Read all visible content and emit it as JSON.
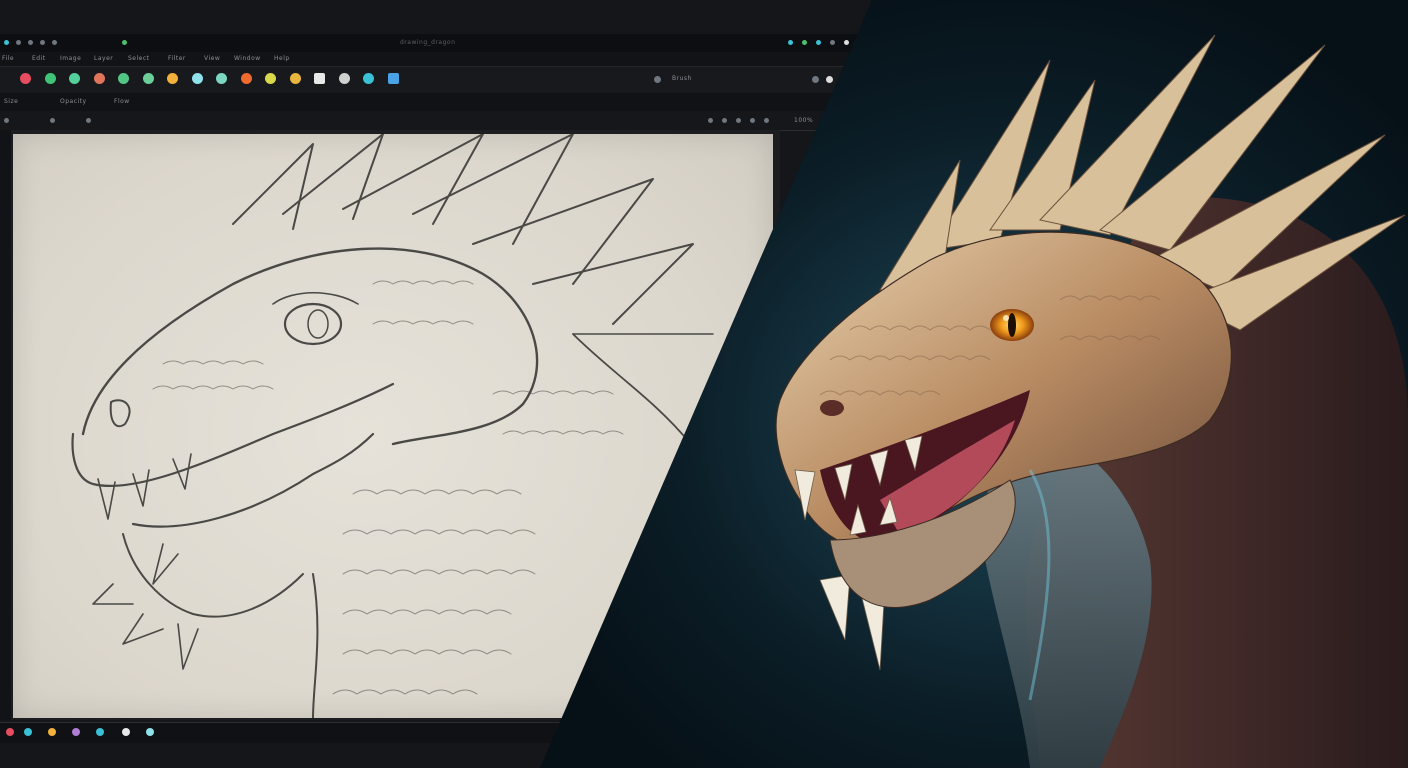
{
  "window": {
    "title": "drawing_dragon"
  },
  "menu": {
    "items": [
      "File",
      "Edit",
      "Image",
      "Layer",
      "Select",
      "Filter",
      "View",
      "Window",
      "Help"
    ]
  },
  "toolbar": {
    "right_label": "Brush",
    "tools": [
      {
        "name": "brush-tool",
        "color": "#e84c5f"
      },
      {
        "name": "pen-tool",
        "color": "#3fc476"
      },
      {
        "name": "pencil-tool",
        "color": "#53d19b"
      },
      {
        "name": "marker-tool",
        "color": "#e0755b"
      },
      {
        "name": "ink-tool",
        "color": "#52c785"
      },
      {
        "name": "smudge-tool",
        "color": "#6ccf9a"
      },
      {
        "name": "fill-tool",
        "color": "#f2b13a"
      },
      {
        "name": "eraser-tool",
        "color": "#8fe1ea"
      },
      {
        "name": "blend-tool",
        "color": "#7cd6c2"
      },
      {
        "name": "color-tool",
        "color": "#f06a2e"
      },
      {
        "name": "picker-tool",
        "color": "#d9d84a"
      },
      {
        "name": "select-tool",
        "color": "#e9b53d"
      },
      {
        "name": "move-tool",
        "color": "#e8e8e8"
      },
      {
        "name": "transform-tool",
        "color": "#d0d0d0"
      },
      {
        "name": "text-tool",
        "color": "#3bc1d6"
      },
      {
        "name": "layer-tool",
        "color": "#4aa3e6"
      }
    ]
  },
  "options": {
    "size_label": "Size",
    "opacity_label": "Opacity",
    "flow_label": "Flow"
  },
  "status": {
    "zoom": "100%"
  },
  "colors": {
    "accent": "#3bc1d6",
    "panel_bg": "#14161a",
    "canvas_paper": "#dcd7cd",
    "dragon_eye": "#f29b1c"
  }
}
